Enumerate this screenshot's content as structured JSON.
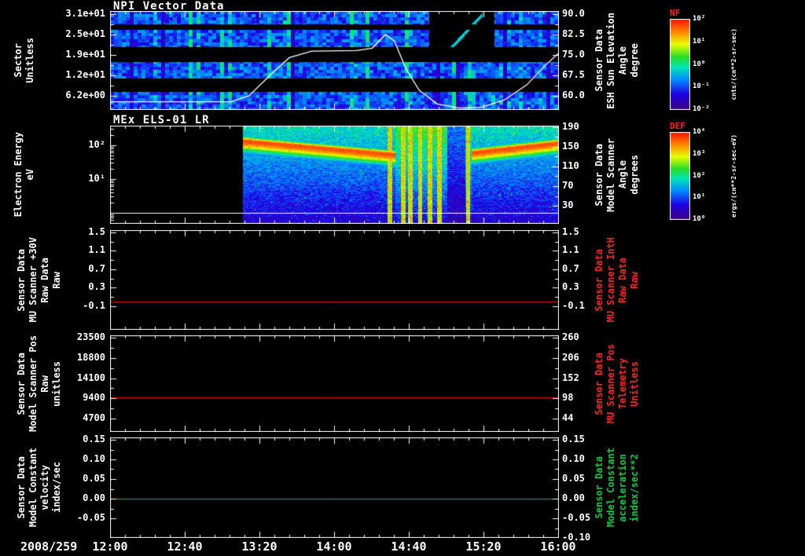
{
  "time_axis": {
    "date": "2008/259",
    "labels": [
      "12:00",
      "12:40",
      "13:20",
      "14:00",
      "14:40",
      "15:20",
      "16:00"
    ]
  },
  "colorbars": [
    {
      "name": "NF",
      "ticks": [
        "10²",
        "10¹",
        "10⁰",
        "10⁻¹",
        "10⁻²"
      ],
      "units": "cnts/(cm**2-sr-sec)"
    },
    {
      "name": "DEF",
      "ticks": [
        "10⁴",
        "10³",
        "10²",
        "10¹",
        "10⁰"
      ],
      "units": "ergs/(cm**2-sr-sec-eV)"
    }
  ],
  "panels": [
    {
      "title": "NPI Vector Data",
      "left_label_lines": [
        "Sector",
        "Unitless"
      ],
      "right_label_lines": [
        "Sensor Data",
        "ESH Sun Elevation",
        "Angle",
        "degree"
      ],
      "right_label_color": "#ffffff"
    },
    {
      "title": "MEx ELS-01 LR",
      "left_label_lines": [
        "Electron Energy",
        "eV"
      ],
      "right_label_lines": [
        "Sensor Data",
        "Model Scanner",
        "Angle",
        "degrees"
      ],
      "right_label_color": "#ffffff"
    },
    {
      "title": "",
      "left_label_lines": [
        "Sensor Data",
        "MU Scanner +30V",
        "Raw Data",
        "Raw"
      ],
      "right_label_lines": [
        "Sensor Data",
        "MU Scanner IntH",
        "Raw Data",
        "Raw"
      ],
      "right_label_color": "#ff2222"
    },
    {
      "title": "",
      "left_label_lines": [
        "Sensor Data",
        "Model Scanner Pos",
        "Raw",
        "unitless"
      ],
      "right_label_lines": [
        "Sensor Data",
        "MU Scanner Pos",
        "Telemetry",
        "Unitless"
      ],
      "right_label_color": "#ff2222"
    },
    {
      "title": "",
      "left_label_lines": [
        "Sensor Data",
        "Model Constant",
        "velocity",
        "index/sec"
      ],
      "right_label_lines": [
        "Sensor Data",
        "Model Constant",
        "acceleration",
        "index/sec**2"
      ],
      "right_label_color": "#00cc44"
    }
  ],
  "chart_data": [
    {
      "type": "heatmap",
      "name": "npi-vector-data",
      "title": "NPI Vector Data",
      "x_start": "12:00",
      "x_end": "16:00",
      "sectors": 32,
      "ylim_left": [
        1.9,
        31.95
      ],
      "yticks_left": [
        {
          "v": 31,
          "label": "3.1e+01"
        },
        {
          "v": 24.8,
          "label": "2.5e+01"
        },
        {
          "v": 18.6,
          "label": "1.9e+01"
        },
        {
          "v": 12.4,
          "label": "1.2e+01"
        },
        {
          "v": 6.2,
          "label": "6.2e+00"
        }
      ],
      "ylim_right": [
        54.8,
        91.15
      ],
      "yticks_right": [
        {
          "v": 90,
          "label": "90.0"
        },
        {
          "v": 82.5,
          "label": "82.5"
        },
        {
          "v": 75,
          "label": "75.0"
        },
        {
          "v": 67.5,
          "label": "67.5"
        },
        {
          "v": 60,
          "label": "60.0"
        }
      ],
      "black_band_fracs": [
        [
          0.127,
          0.19
        ],
        [
          0.365,
          0.51
        ],
        [
          0.675,
          0.81
        ]
      ],
      "data_gap": {
        "x": [
          0.71,
          0.855
        ],
        "y": [
          0.0,
          0.45
        ]
      },
      "overlay_line": {
        "label": "ESH Sun Elevation Angle",
        "color": "#ffffff",
        "axis": "right",
        "points": [
          [
            0,
            57.8
          ],
          [
            0.27,
            57.8
          ],
          [
            0.31,
            60
          ],
          [
            0.36,
            68
          ],
          [
            0.4,
            74
          ],
          [
            0.45,
            76.4
          ],
          [
            0.55,
            76.6
          ],
          [
            0.585,
            77.5
          ],
          [
            0.615,
            82.5
          ],
          [
            0.635,
            80
          ],
          [
            0.66,
            70
          ],
          [
            0.69,
            62
          ],
          [
            0.73,
            57
          ],
          [
            0.78,
            55.5
          ],
          [
            0.83,
            55.8
          ],
          [
            0.88,
            58.5
          ],
          [
            0.93,
            64
          ],
          [
            0.97,
            71
          ],
          [
            1,
            75.5
          ]
        ]
      }
    },
    {
      "type": "heatmap",
      "name": "mex-els-01-lr",
      "title": "MEx ELS-01 LR",
      "ylog_left": true,
      "ylim_left_log": [
        -0.33,
        2.58
      ],
      "yticks_left": [
        {
          "v": 2,
          "label": "10²"
        },
        {
          "v": 1,
          "label": "10¹"
        }
      ],
      "ylim_right": [
        -6.8,
        193.2
      ],
      "yticks_right": [
        {
          "v": 190,
          "label": "190"
        },
        {
          "v": 150,
          "label": "150"
        },
        {
          "v": 110,
          "label": "110"
        },
        {
          "v": 70,
          "label": "70"
        },
        {
          "v": 30,
          "label": "30"
        }
      ],
      "data_start_frac": 0.295,
      "white_line_frac": 0.89,
      "red_band": {
        "start_frac": 0.295,
        "fade_frac": 0.635,
        "resume_frac": 0.805,
        "center_start": 0.15,
        "center_end": 0.29,
        "resume_center": 0.27,
        "resume_center_end": 0.17
      },
      "green_streak_fracs": [
        0.622,
        0.652,
        0.668,
        0.69,
        0.712,
        0.733,
        0.797
      ],
      "quiet_region": [
        0.75,
        0.79
      ]
    },
    {
      "type": "line",
      "name": "mu-scanner-30v-raw",
      "ylim_left": [
        -0.61,
        1.55
      ],
      "yticks_left": [
        {
          "v": 1.5,
          "label": "1.5"
        },
        {
          "v": 1.1,
          "label": "1.1"
        },
        {
          "v": 0.7,
          "label": "0.7"
        },
        {
          "v": 0.3,
          "label": "0.3"
        },
        {
          "v": -0.1,
          "label": "-0.1"
        }
      ],
      "ylim_right": [
        -0.61,
        1.55
      ],
      "yticks_right": [
        {
          "v": 1.5,
          "label": "1.5"
        },
        {
          "v": 1.1,
          "label": "1.1"
        },
        {
          "v": 0.7,
          "label": "0.7"
        },
        {
          "v": 0.3,
          "label": "0.3"
        },
        {
          "v": -0.1,
          "label": "-0.1"
        }
      ],
      "series": [
        {
          "name": "MU Scanner +30V Raw Data",
          "color": "#dd1111",
          "value": 0.0
        }
      ]
    },
    {
      "type": "line",
      "name": "model-scanner-pos-raw",
      "ylim_left": [
        1598,
        24048
      ],
      "yticks_left": [
        {
          "v": 23500,
          "label": "23500"
        },
        {
          "v": 18800,
          "label": "18800"
        },
        {
          "v": 14100,
          "label": "14100"
        },
        {
          "v": 9400,
          "label": "9400"
        },
        {
          "v": 4700,
          "label": "4700"
        }
      ],
      "ylim_right": [
        8.4,
        266.3
      ],
      "yticks_right": [
        {
          "v": 260,
          "label": "260"
        },
        {
          "v": 206,
          "label": "206"
        },
        {
          "v": 152,
          "label": "152"
        },
        {
          "v": 98,
          "label": "98"
        },
        {
          "v": 44,
          "label": "44"
        }
      ],
      "series": [
        {
          "name": "Model Scanner Pos Raw",
          "color": "#dd1111",
          "value": 9600
        }
      ]
    },
    {
      "type": "line",
      "name": "model-constant-velocity",
      "ylim_left": [
        -0.1,
        0.156
      ],
      "yticks_left": [
        {
          "v": 0.15,
          "label": "0.15"
        },
        {
          "v": 0.1,
          "label": "0.10"
        },
        {
          "v": 0.05,
          "label": "0.05"
        },
        {
          "v": 0,
          "label": "0.00"
        },
        {
          "v": -0.05,
          "label": "-0.05"
        }
      ],
      "ylim_right": [
        -0.1,
        0.156
      ],
      "yticks_right": [
        {
          "v": 0.15,
          "label": "0.15"
        },
        {
          "v": 0.1,
          "label": "0.10"
        },
        {
          "v": 0.05,
          "label": "0.05"
        },
        {
          "v": 0,
          "label": "0.00"
        },
        {
          "v": -0.05,
          "label": "-0.05"
        },
        {
          "v": -0.1,
          "label": "-0.10"
        }
      ],
      "series": [
        {
          "name": "Model Constant velocity",
          "color": "#00c24a",
          "value": 0.0
        }
      ]
    }
  ]
}
